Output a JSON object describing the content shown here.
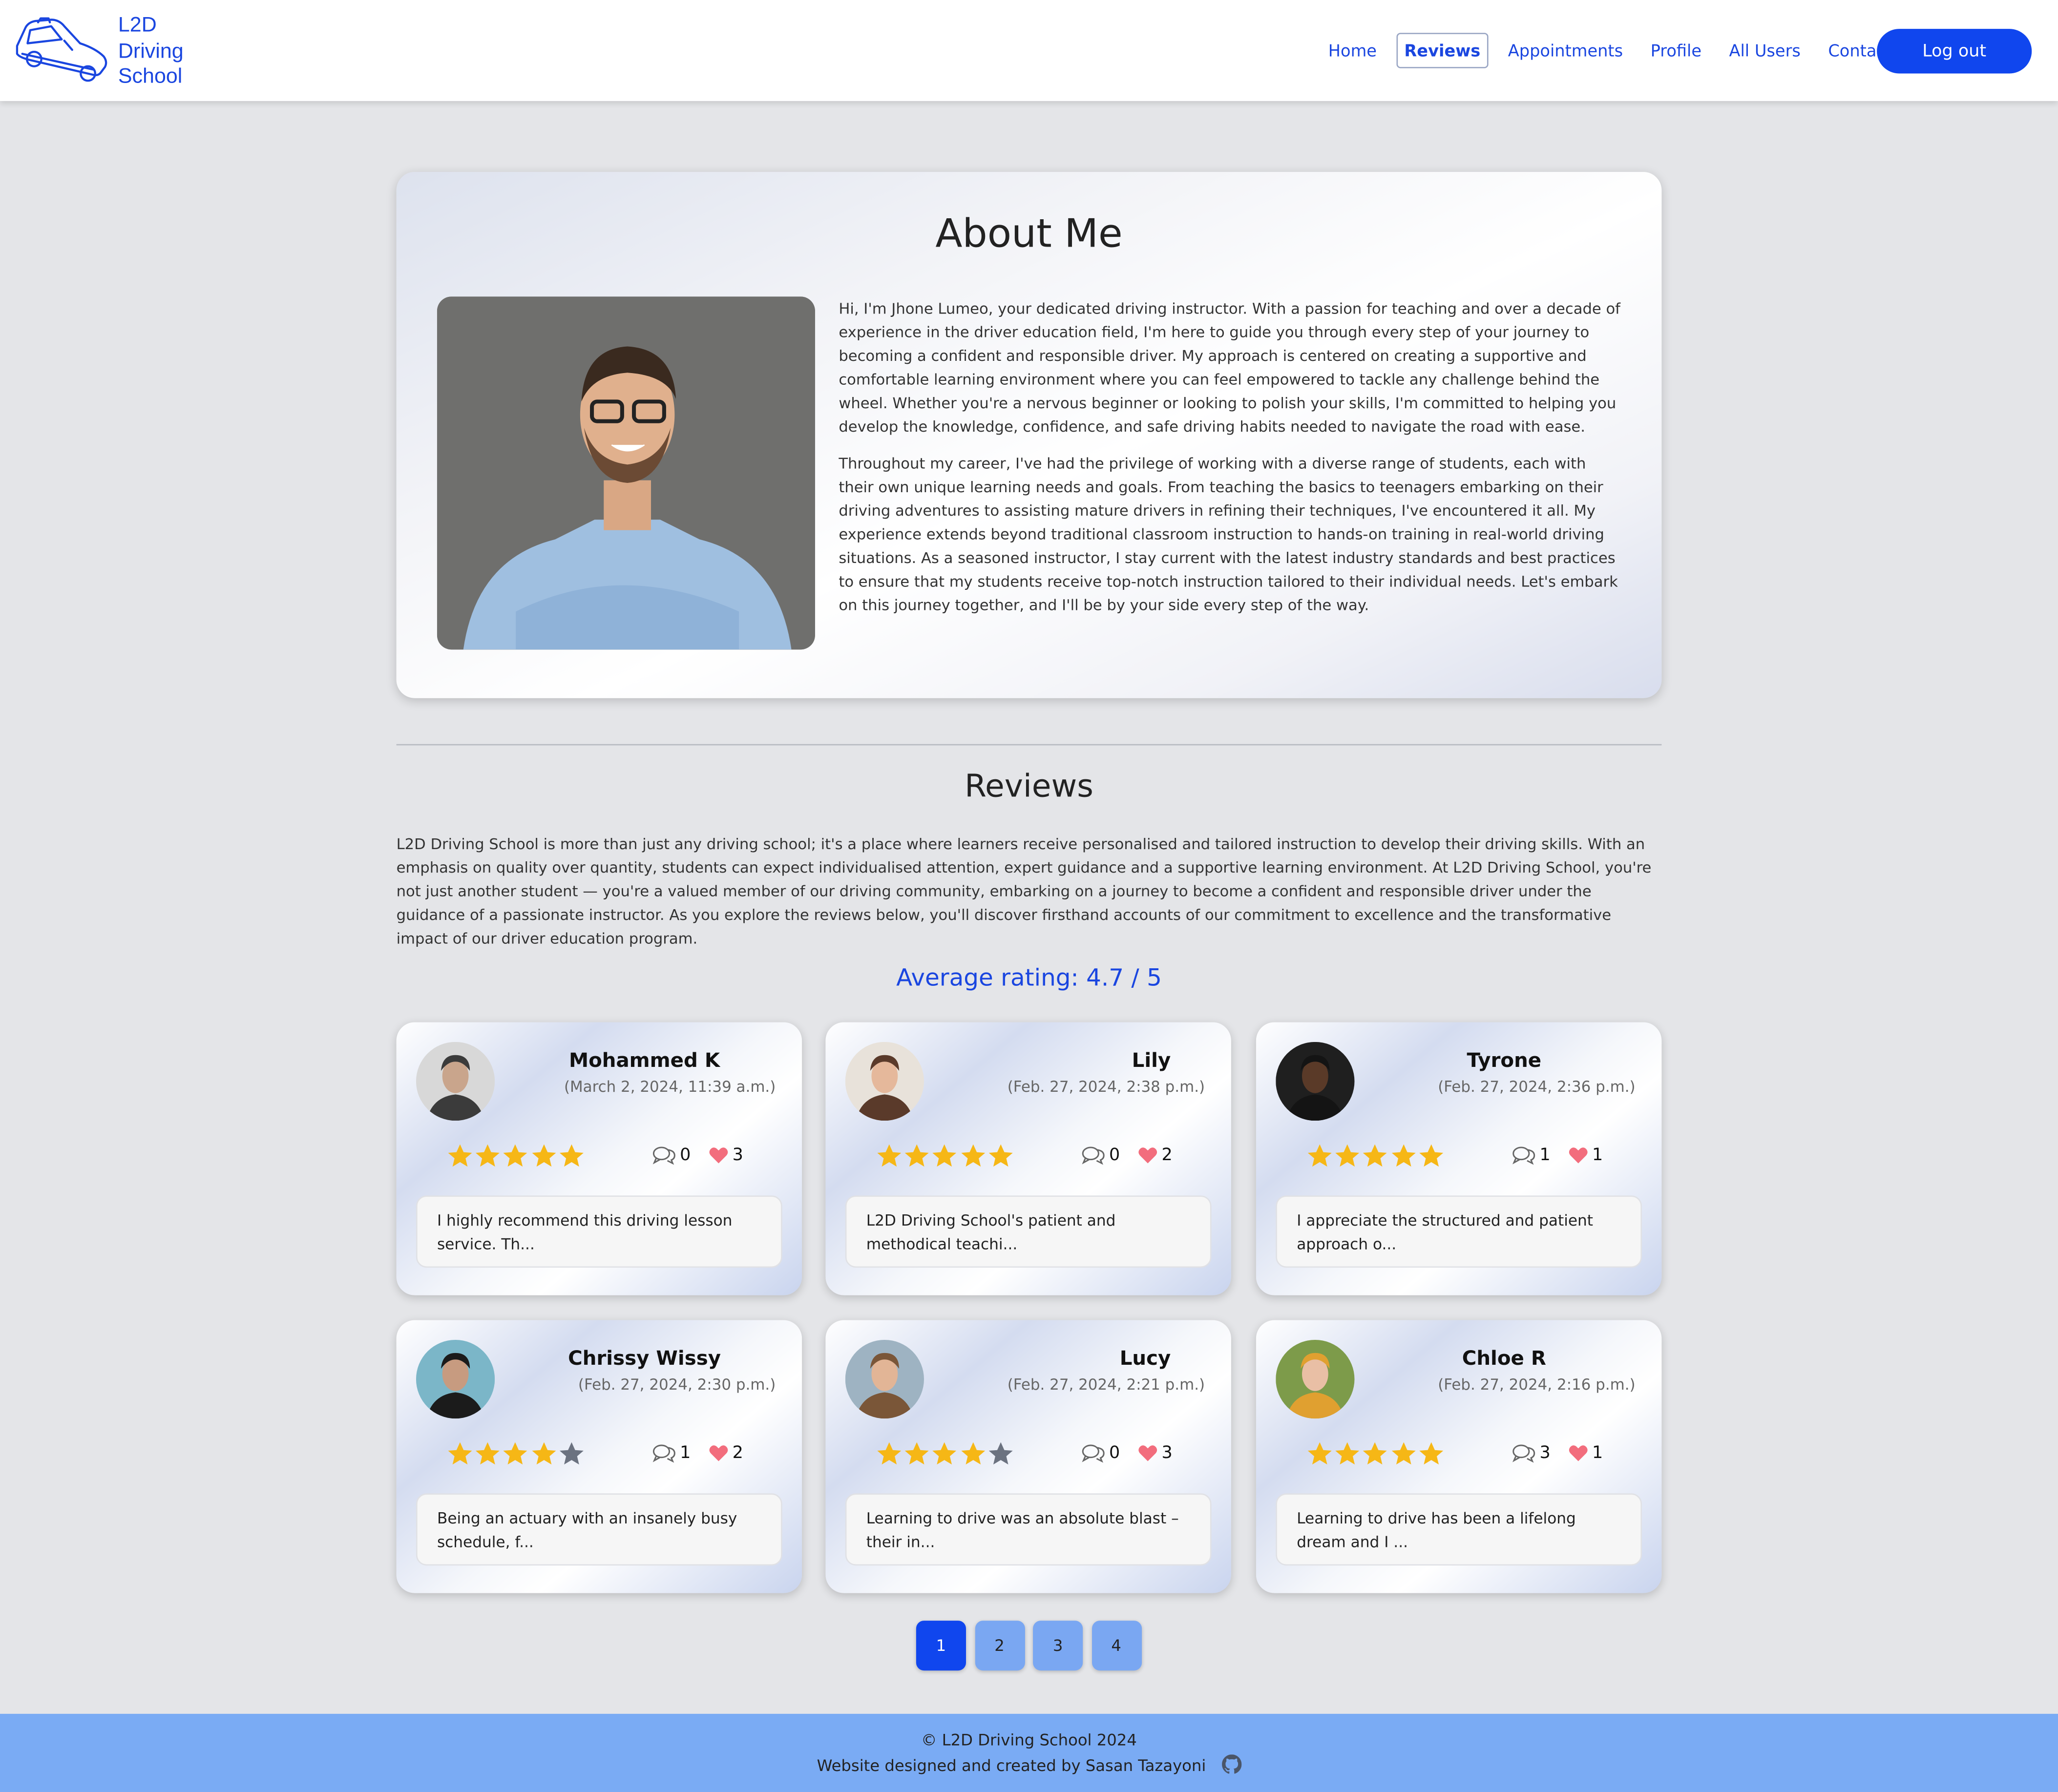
{
  "brand": {
    "line1": "L2D",
    "line2": "Driving",
    "line3": "School",
    "logo_icon": "car-icon",
    "color": "#1a46e0"
  },
  "nav": {
    "links": [
      {
        "label": "Home",
        "active": false
      },
      {
        "label": "Reviews",
        "active": true
      },
      {
        "label": "Appointments",
        "active": false
      },
      {
        "label": "Profile",
        "active": false
      },
      {
        "label": "All Users",
        "active": false
      },
      {
        "label": "Contact",
        "active": false
      }
    ],
    "logout_label": "Log out"
  },
  "about": {
    "title": "About Me",
    "paragraphs": [
      "Hi, I'm Jhone Lumeo, your dedicated driving instructor. With a passion for teaching and over a decade of experience in the driver education field, I'm here to guide you through every step of your journey to becoming a confident and responsible driver. My approach is centered on creating a supportive and comfortable learning environment where you can feel empowered to tackle any challenge behind the wheel. Whether you're a nervous beginner or looking to polish your skills, I'm committed to helping you develop the knowledge, confidence, and safe driving habits needed to navigate the road with ease.",
      "Throughout my career, I've had the privilege of working with a diverse range of students, each with their own unique learning needs and goals. From teaching the basics to teenagers embarking on their driving adventures to assisting mature drivers in refining their techniques, I've encountered it all. My experience extends beyond traditional classroom instruction to hands-on training in real-world driving situations. As a seasoned instructor, I stay current with the latest industry standards and best practices to ensure that my students receive top-notch instruction tailored to their individual needs. Let's embark on this journey together, and I'll be by your side every step of the way."
    ]
  },
  "reviews": {
    "title": "Reviews",
    "intro": "L2D Driving School is more than just any driving school; it's a place where learners receive personalised and tailored instruction to develop their driving skills. With an emphasis on quality over quantity, students can expect individualised attention, expert guidance and a supportive learning environment. At L2D Driving School, you're not just another student — you're a valued member of our driving community, embarking on a journey to become a confident and responsible driver under the guidance of a passionate instructor. As you explore the reviews below, you'll discover firsthand accounts of our commitment to excellence and the transformative impact of our driver education program.",
    "average": "Average rating: 4.7 / 5",
    "items": [
      {
        "name": "Mohammed K",
        "date": "(March 2, 2024, 11:39 a.m.)",
        "rating": 5,
        "comments": "0",
        "likes": "3",
        "snippet": "I highly recommend this driving lesson service. Th..."
      },
      {
        "name": "Lily",
        "date": "(Feb. 27, 2024, 2:38 p.m.)",
        "rating": 5,
        "comments": "0",
        "likes": "2",
        "snippet": "L2D Driving School's patient and methodical teachi..."
      },
      {
        "name": "Tyrone",
        "date": "(Feb. 27, 2024, 2:36 p.m.)",
        "rating": 5,
        "comments": "1",
        "likes": "1",
        "snippet": "I appreciate the structured and patient approach o..."
      },
      {
        "name": "Chrissy Wissy",
        "date": "(Feb. 27, 2024, 2:30 p.m.)",
        "rating": 4,
        "comments": "1",
        "likes": "2",
        "snippet": "Being an actuary with an insanely busy schedule, f..."
      },
      {
        "name": "Lucy",
        "date": "(Feb. 27, 2024, 2:21 p.m.)",
        "rating": 4,
        "comments": "0",
        "likes": "3",
        "snippet": "Learning to drive was an absolute blast – their in..."
      },
      {
        "name": "Chloe R",
        "date": "(Feb. 27, 2024, 2:16 p.m.)",
        "rating": 5,
        "comments": "3",
        "likes": "1",
        "snippet": "Learning to drive has been a lifelong dream and I ..."
      }
    ]
  },
  "pagination": {
    "pages": [
      "1",
      "2",
      "3",
      "4"
    ],
    "current": "1"
  },
  "footer": {
    "copyright": "© L2D Driving School 2024",
    "credit": "Website designed and created by Sasan Tazayoni",
    "icon": "github-icon"
  },
  "colors": {
    "accent": "#1046ee",
    "star": "#f6b716",
    "star_empty": "#6b7280",
    "heart": "#f26d7d",
    "footer": "#7aabf4"
  }
}
